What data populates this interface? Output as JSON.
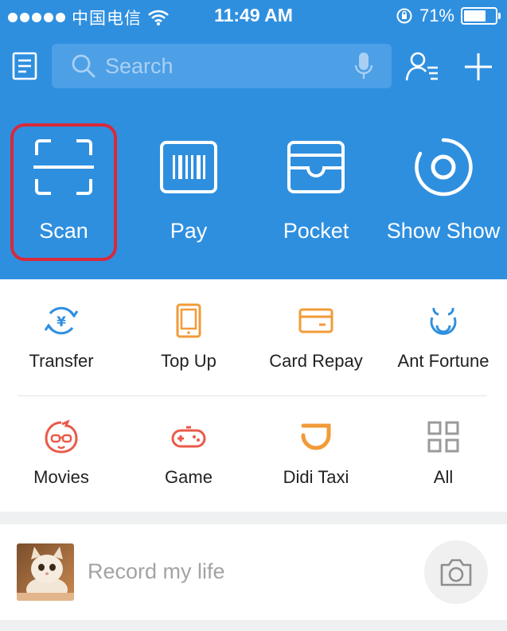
{
  "status_bar": {
    "carrier": "中国电信",
    "time": "11:49 AM",
    "battery_percent": "71%",
    "battery_level": 0.71
  },
  "search": {
    "placeholder": "Search"
  },
  "quick_actions": [
    {
      "label": "Scan",
      "icon": "scan-icon",
      "highlighted": true
    },
    {
      "label": "Pay",
      "icon": "barcode-pay-icon"
    },
    {
      "label": "Pocket",
      "icon": "wallet-icon"
    },
    {
      "label": "Show Show",
      "icon": "show-circle-icon"
    }
  ],
  "services": [
    {
      "label": "Transfer",
      "icon": "transfer-icon",
      "color": "#2f8fdf"
    },
    {
      "label": "Top Up",
      "icon": "phone-icon",
      "color": "#f29b38"
    },
    {
      "label": "Card Repay",
      "icon": "card-icon",
      "color": "#f29b38"
    },
    {
      "label": "Ant Fortune",
      "icon": "ant-fortune-icon",
      "color": "#2f8fdf"
    },
    {
      "label": "Movies",
      "icon": "movies-face-icon",
      "color": "#ea5a4a"
    },
    {
      "label": "Game",
      "icon": "gamepad-icon",
      "color": "#ea5a4a"
    },
    {
      "label": "Didi Taxi",
      "icon": "didi-icon",
      "color": "#f29b38"
    },
    {
      "label": "All",
      "icon": "grid-icon",
      "color": "#9a9a9a"
    }
  ],
  "record": {
    "placeholder": "Record my life",
    "avatar": "cat-avatar",
    "action_icon": "camera-icon"
  },
  "colors": {
    "header_blue": "#2f8fdf",
    "highlight_red": "#d9293a"
  }
}
